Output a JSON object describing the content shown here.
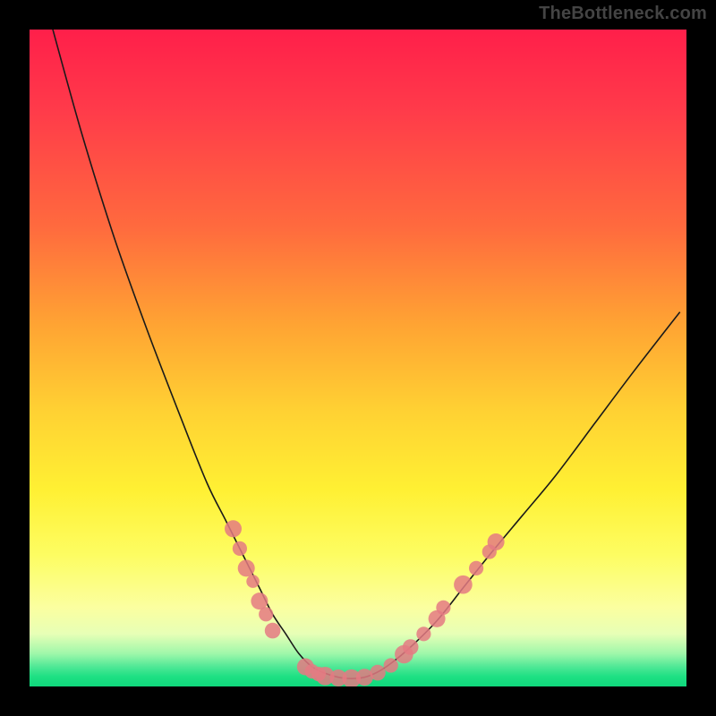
{
  "watermark": "TheBottleneck.com",
  "chart_data": {
    "type": "line",
    "title": "",
    "xlabel": "",
    "ylabel": "",
    "xlim": [
      0,
      100
    ],
    "ylim": [
      0,
      100
    ],
    "grid": false,
    "legend": false,
    "series": [
      {
        "name": "bottleneck-curve",
        "x": [
          3,
          8,
          13,
          18,
          23,
          27,
          30,
          33,
          35,
          37,
          39,
          41,
          43,
          45,
          47,
          49,
          51,
          53,
          55,
          58,
          62,
          66,
          70,
          75,
          80,
          86,
          92,
          99
        ],
        "y": [
          102,
          84,
          68,
          54,
          41,
          31,
          25,
          19,
          15,
          11,
          8,
          5,
          3,
          2,
          1.4,
          1.2,
          1.4,
          2.2,
          3.5,
          6,
          10,
          15,
          20,
          26,
          32,
          40,
          48,
          57
        ]
      }
    ],
    "markers": [
      {
        "x": 31,
        "y": 24,
        "r": 1.3
      },
      {
        "x": 32,
        "y": 21,
        "r": 1.1
      },
      {
        "x": 33,
        "y": 18,
        "r": 1.3
      },
      {
        "x": 34,
        "y": 16,
        "r": 1.0
      },
      {
        "x": 35,
        "y": 13,
        "r": 1.3
      },
      {
        "x": 36,
        "y": 11,
        "r": 1.1
      },
      {
        "x": 37,
        "y": 8.5,
        "r": 1.2
      },
      {
        "x": 42,
        "y": 3,
        "r": 1.3
      },
      {
        "x": 43,
        "y": 2.3,
        "r": 1.1
      },
      {
        "x": 44,
        "y": 1.9,
        "r": 1.1
      },
      {
        "x": 45,
        "y": 1.6,
        "r": 1.4
      },
      {
        "x": 47,
        "y": 1.3,
        "r": 1.3
      },
      {
        "x": 49,
        "y": 1.2,
        "r": 1.4
      },
      {
        "x": 51,
        "y": 1.4,
        "r": 1.3
      },
      {
        "x": 53,
        "y": 2.1,
        "r": 1.2
      },
      {
        "x": 55,
        "y": 3.2,
        "r": 1.1
      },
      {
        "x": 57,
        "y": 4.9,
        "r": 1.4
      },
      {
        "x": 58,
        "y": 6.0,
        "r": 1.2
      },
      {
        "x": 60,
        "y": 8.0,
        "r": 1.1
      },
      {
        "x": 62,
        "y": 10.3,
        "r": 1.3
      },
      {
        "x": 63,
        "y": 12.0,
        "r": 1.1
      },
      {
        "x": 66,
        "y": 15.5,
        "r": 1.4
      },
      {
        "x": 68,
        "y": 18.0,
        "r": 1.1
      },
      {
        "x": 70,
        "y": 20.5,
        "r": 1.1
      },
      {
        "x": 71,
        "y": 22.0,
        "r": 1.3
      }
    ],
    "colors": {
      "curve": "#1a1a1a",
      "marker": "#e47a83",
      "gradient_top": "#ff1f4a",
      "gradient_bottom": "#0fd87c"
    }
  }
}
